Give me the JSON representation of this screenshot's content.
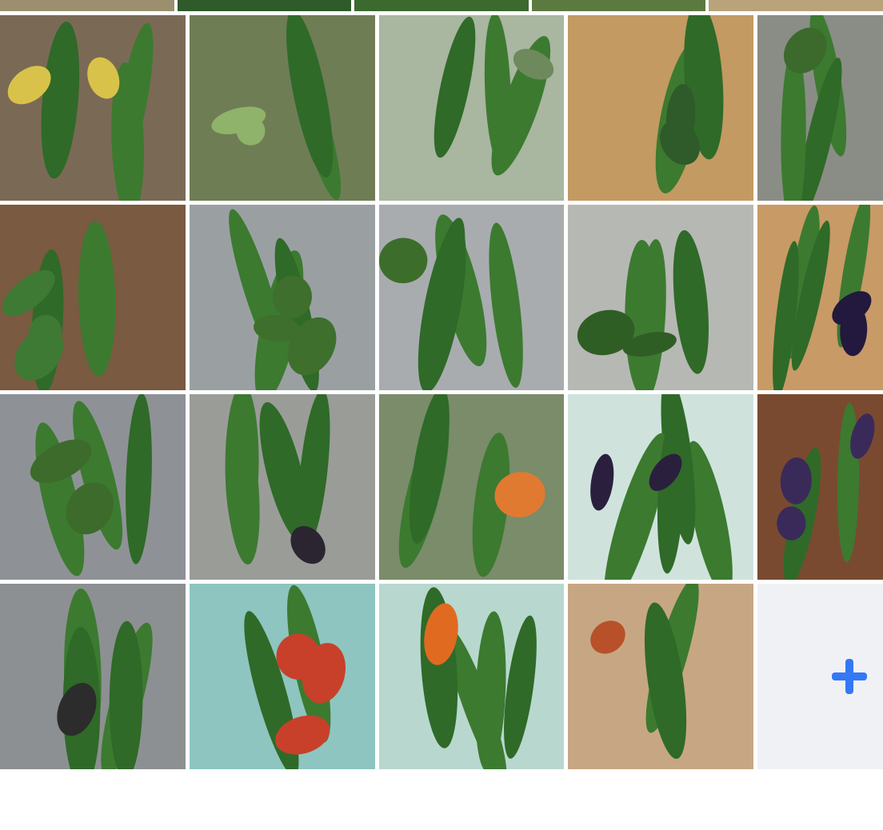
{
  "gallery": {
    "top_strip_colors": [
      "#9c8f6e",
      "#2f5a2a",
      "#3a6a2e",
      "#5c7a40",
      "#b9a37a"
    ],
    "tiles": [
      {
        "id": "photo-1",
        "bg": "#7a6a55",
        "subject": "cucumber-vine-flowers",
        "accent": "#d9c24a"
      },
      {
        "id": "photo-2",
        "bg": "#6f7d55",
        "subject": "cucumber-on-vine",
        "accent": "#8fb36a"
      },
      {
        "id": "photo-3",
        "bg": "#a9b6a0",
        "subject": "cucumber-on-vine",
        "accent": "#6e8a5c"
      },
      {
        "id": "photo-4",
        "bg": "#c39a62",
        "subject": "three-cucumbers-board",
        "accent": "#2f5a2a"
      },
      {
        "id": "photo-5",
        "bg": "#8a8d86",
        "subject": "cucumbers-in-sink",
        "accent": "#3b6a2c"
      },
      {
        "id": "photo-6",
        "bg": "#7a5a40",
        "subject": "three-cucumbers-table",
        "accent": "#3e7a34"
      },
      {
        "id": "photo-7",
        "bg": "#9aa0a2",
        "subject": "two-cucumbers-sink",
        "accent": "#3f6f2c"
      },
      {
        "id": "photo-8",
        "bg": "#a8acaf",
        "subject": "three-cucumbers-sink",
        "accent": "#3d6d2b"
      },
      {
        "id": "photo-9",
        "bg": "#b6b8b4",
        "subject": "three-cucumbers-rack",
        "accent": "#2f5e24"
      },
      {
        "id": "photo-10",
        "bg": "#c89a66",
        "subject": "eggplant-cucumber",
        "accent": "#23183d"
      },
      {
        "id": "photo-11",
        "bg": "#8e9296",
        "subject": "two-cucumbers-sink",
        "accent": "#3d6b2b"
      },
      {
        "id": "photo-12",
        "bg": "#9a9c98",
        "subject": "cucumbers-eggplant",
        "accent": "#2a2530"
      },
      {
        "id": "photo-13",
        "bg": "#7a8c6a",
        "subject": "cucumbers-herbs-tomatoes",
        "accent": "#e07a30"
      },
      {
        "id": "photo-14",
        "bg": "#cfe3dc",
        "subject": "basket-eggplant-beans",
        "accent": "#2b1f3e"
      },
      {
        "id": "photo-15",
        "bg": "#7a4a30",
        "subject": "eggplant-cucumbers-tomatoes",
        "accent": "#3a2a5a"
      },
      {
        "id": "photo-16",
        "bg": "#8d9092",
        "subject": "four-cucumbers-eggplant",
        "accent": "#2c2c2c"
      },
      {
        "id": "photo-17",
        "bg": "#8ec5c0",
        "subject": "basket-tomatoes-greens",
        "accent": "#c8402a"
      },
      {
        "id": "photo-18",
        "bg": "#b8d8cf",
        "subject": "basket-cucumbers-tomatoes",
        "accent": "#e06a20"
      },
      {
        "id": "photo-19",
        "bg": "#c7a783",
        "subject": "cucumber-small-tomatoes",
        "accent": "#b8502a"
      }
    ],
    "add_button": {
      "icon": "plus-icon",
      "color": "#3478f6"
    }
  }
}
